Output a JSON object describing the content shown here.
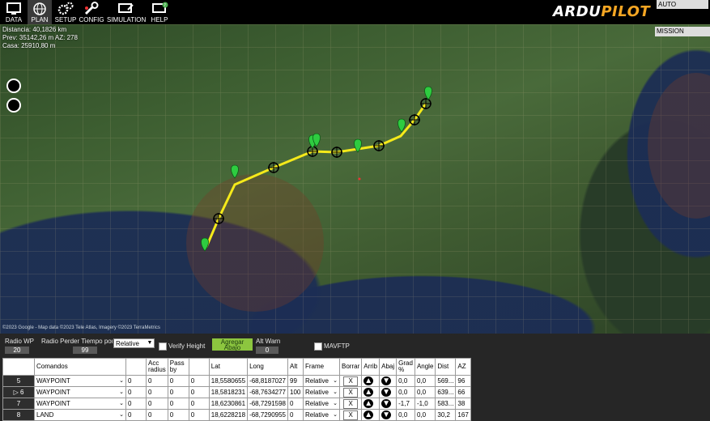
{
  "topbar": {
    "menu": [
      {
        "label": "DATA",
        "icon": "monitor-icon"
      },
      {
        "label": "PLAN",
        "icon": "globe-icon"
      },
      {
        "label": "SETUP",
        "icon": "gears-icon"
      },
      {
        "label": "CONFIG",
        "icon": "wrench-icon"
      },
      {
        "label": "SIMULATION",
        "icon": "simulation-icon"
      },
      {
        "label": "HELP",
        "icon": "help-monitor-icon"
      }
    ],
    "logo_white": "ARDU",
    "logo_orange": "PILOT",
    "mode": "AUTO"
  },
  "map": {
    "info_lines": [
      "Distancia: 40,1826 km",
      "Prev: 35142,26 m AZ: 278",
      "Casa: 25910,80 m"
    ],
    "mission_select": "MISSION",
    "copyright": "©2023 Google - Map data ©2023 Tele Atlas, Imagery ©2023 TerraMetrics",
    "route_color": "#f5ea1a",
    "marker_color": "#2ecc40"
  },
  "controls": {
    "radio_wp_label": "Radio WP",
    "radio_wp_value": "20",
    "loiter_label": "Radio Perder Tiempo por D",
    "loiter_value": "99",
    "frame_value": "Relative",
    "verify_height_label": "Verify Height",
    "add_below_label": "Agregar Abajo",
    "alt_warn_label": "Alt Warn",
    "alt_warn_value": "0",
    "mavftp_label": "MAVFTP"
  },
  "table": {
    "headers": [
      "",
      "Comandos",
      "",
      "Acc radius",
      "Pass by",
      "",
      "Lat",
      "Long",
      "Alt",
      "Frame",
      "Borrar",
      "Arrib",
      "Abaj",
      "Grad %",
      "Angle",
      "Dist",
      "AZ"
    ],
    "rows": [
      {
        "num": "5",
        "cmd": "WAYPOINT",
        "p1": "0",
        "p2": "0",
        "p3": "0",
        "p4": "0",
        "lat": "18,5580655",
        "lng": "-68,8187027",
        "alt": "99",
        "frame": "Relative",
        "del": "X",
        "grad": "0,0",
        "angle": "0,0",
        "dist": "569...",
        "az": "96",
        "current": false
      },
      {
        "num": "6",
        "cmd": "WAYPOINT",
        "p1": "0",
        "p2": "0",
        "p3": "0",
        "p4": "0",
        "lat": "18,5818231",
        "lng": "-68,7634277",
        "alt": "100",
        "frame": "Relative",
        "del": "X",
        "grad": "0,0",
        "angle": "0,0",
        "dist": "639...",
        "az": "66",
        "current": true
      },
      {
        "num": "7",
        "cmd": "WAYPOINT",
        "p1": "0",
        "p2": "0",
        "p3": "0",
        "p4": "0",
        "lat": "18,6230861",
        "lng": "-68,7291598",
        "alt": "0",
        "frame": "Relative",
        "del": "X",
        "grad": "-1,7",
        "angle": "-1,0",
        "dist": "583...",
        "az": "38",
        "current": false
      },
      {
        "num": "8",
        "cmd": "LAND",
        "p1": "0",
        "p2": "0",
        "p3": "0",
        "p4": "0",
        "lat": "18,6228218",
        "lng": "-68,7290955",
        "alt": "0",
        "frame": "Relative",
        "del": "X",
        "grad": "0,0",
        "angle": "0,0",
        "dist": "30,2",
        "az": "167",
        "current": false
      }
    ]
  }
}
